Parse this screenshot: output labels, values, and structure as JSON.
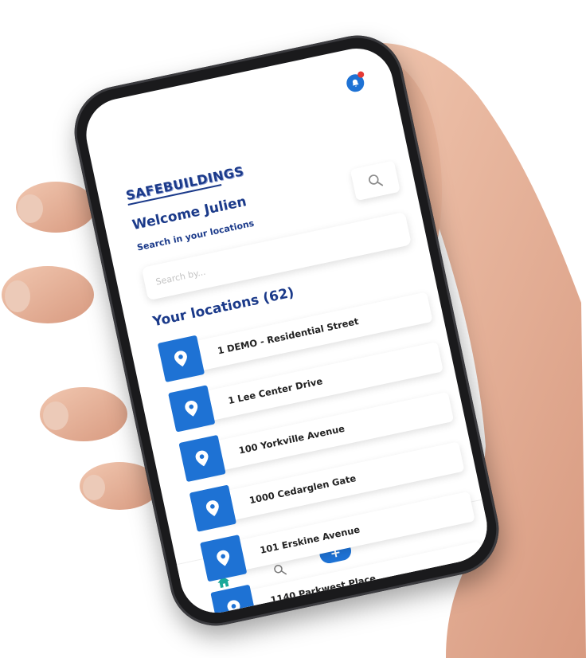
{
  "app": {
    "logo_text": "SAFEBUILDINGS",
    "welcome": "Welcome Julien",
    "search_caption": "Search in your locations",
    "search_placeholder": "Search by...",
    "locations_title": "Your locations (62)"
  },
  "locations": [
    {
      "label": "1 DEMO - Residential Street"
    },
    {
      "label": "1 Lee Center Drive"
    },
    {
      "label": "100 Yorkville Avenue"
    },
    {
      "label": "1000 Cedarglen Gate"
    },
    {
      "label": "101 Erskine Avenue"
    },
    {
      "label": "1140 Parkwest Place"
    }
  ],
  "nav": {
    "add_label": "+",
    "help_label": "?"
  },
  "colors": {
    "brand": "#1b3a8a",
    "accent": "#1e72d4",
    "home_active": "#1aa89a",
    "notification_dot": "#e53935"
  },
  "icons": {
    "notification": "bell-icon",
    "search": "search-icon",
    "pin": "map-pin-icon",
    "home": "home-icon",
    "scan": "scan-icon",
    "help": "help-icon"
  }
}
